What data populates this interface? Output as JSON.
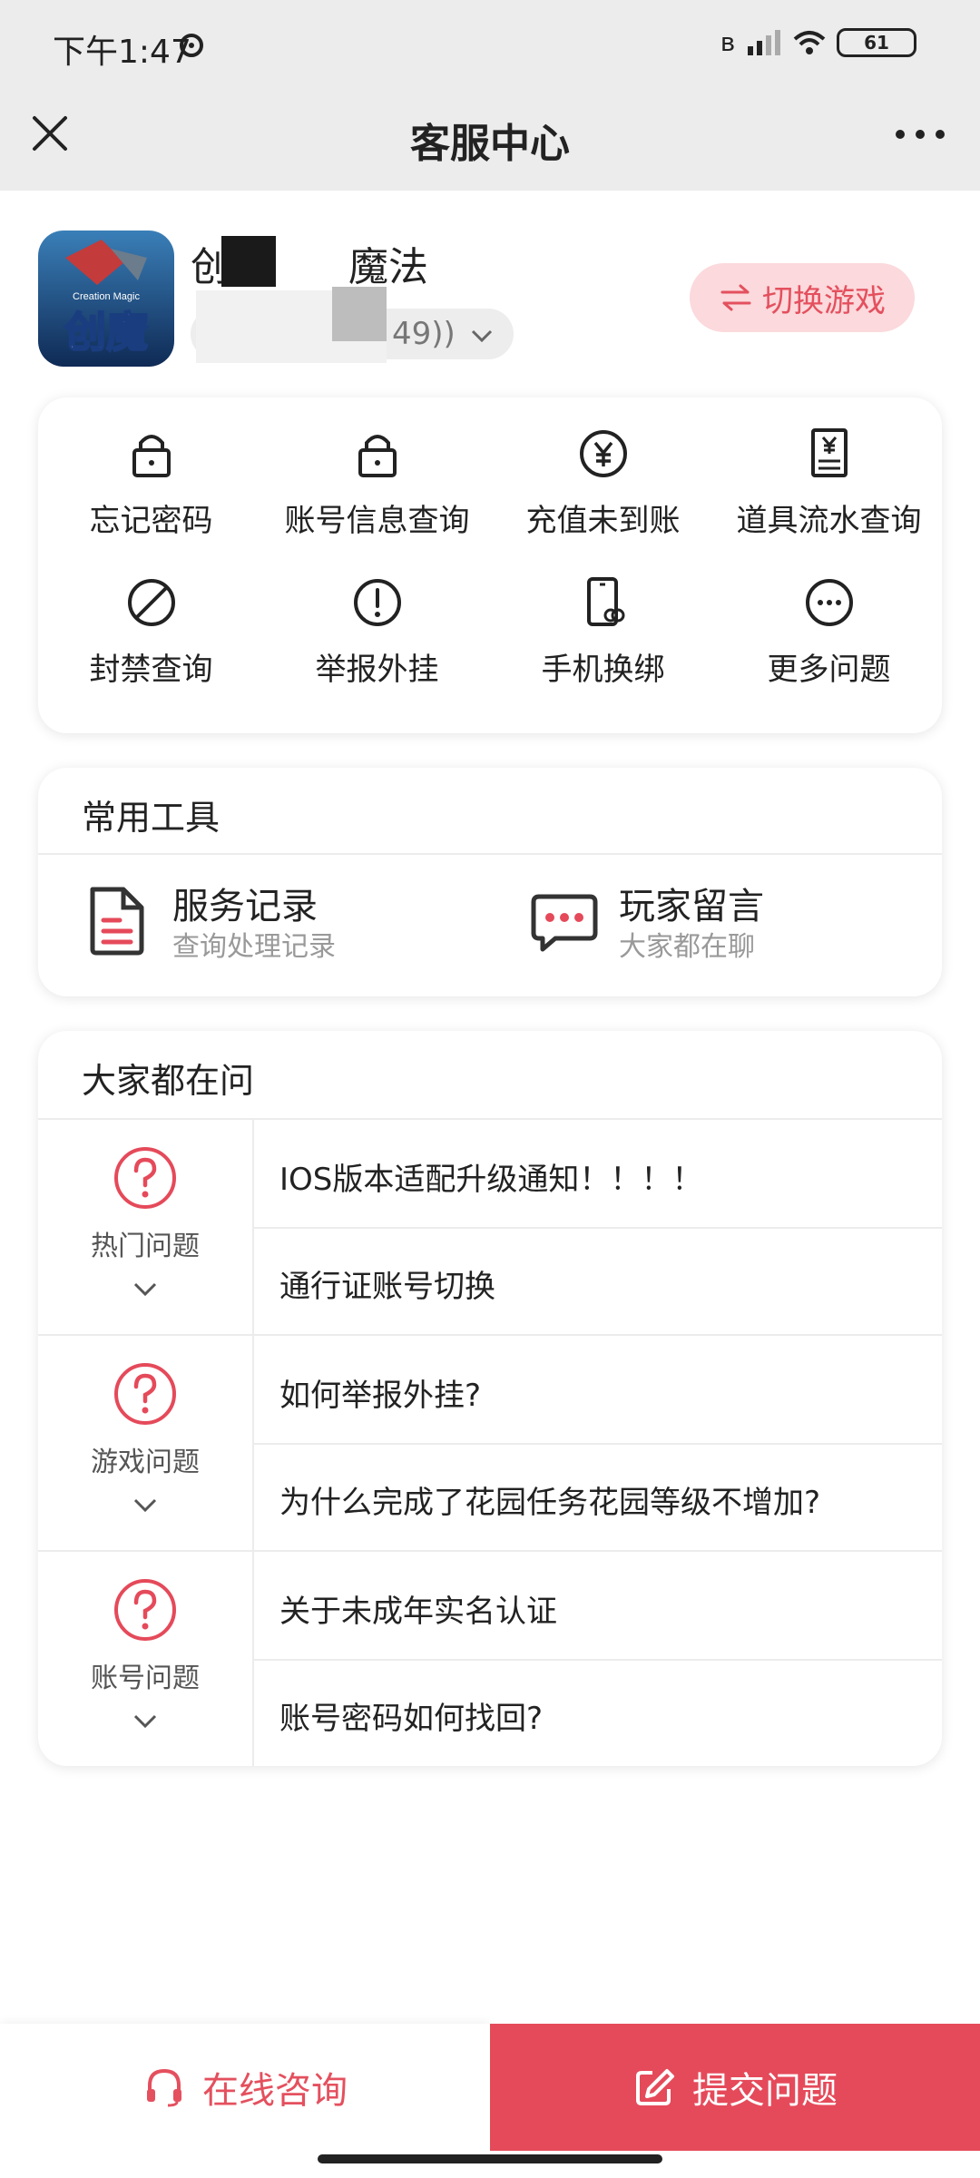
{
  "status_bar": {
    "time": "下午1:47",
    "battery": "61"
  },
  "header": {
    "title": "客服中心"
  },
  "game": {
    "name_part1": "创",
    "name_part2": "魔法",
    "server": "49))",
    "switch_label": "切换游戏",
    "logo_text": "创魔",
    "logo_subtext": "Creation Magic"
  },
  "quick_actions": [
    {
      "label": "忘记密码",
      "icon": "lock-icon"
    },
    {
      "label": "账号信息查询",
      "icon": "lock-icon"
    },
    {
      "label": "充值未到账",
      "icon": "yuan-icon"
    },
    {
      "label": "道具流水查询",
      "icon": "receipt-icon"
    },
    {
      "label": "封禁查询",
      "icon": "ban-icon"
    },
    {
      "label": "举报外挂",
      "icon": "alert-icon"
    },
    {
      "label": "手机换绑",
      "icon": "phone-link-icon"
    },
    {
      "label": "更多问题",
      "icon": "more-circle-icon"
    }
  ],
  "tools": {
    "title": "常用工具",
    "items": [
      {
        "title": "服务记录",
        "subtitle": "查询处理记录",
        "icon": "document-icon"
      },
      {
        "title": "玩家留言",
        "subtitle": "大家都在聊",
        "icon": "chat-bubble-icon"
      }
    ]
  },
  "faq": {
    "title": "大家都在问",
    "groups": [
      {
        "category": "热门问题",
        "questions": [
          "IOS版本适配升级通知！！！！",
          "通行证账号切换"
        ]
      },
      {
        "category": "游戏问题",
        "questions": [
          "如何举报外挂?",
          "为什么完成了花园任务花园等级不增加?"
        ]
      },
      {
        "category": "账号问题",
        "questions": [
          "关于未成年实名认证",
          "账号密码如何找回?"
        ]
      }
    ]
  },
  "bottom": {
    "online": "在线咨询",
    "submit": "提交问题"
  },
  "colors": {
    "accent": "#e54a5a",
    "accent_light": "#fbd9dc"
  }
}
